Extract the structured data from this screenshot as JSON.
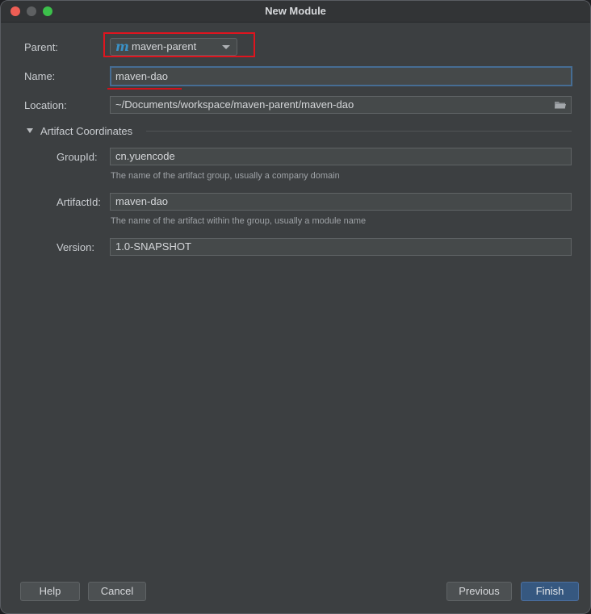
{
  "window": {
    "title": "New Module"
  },
  "form": {
    "parent": {
      "label": "Parent:",
      "value": "maven-parent",
      "icon": "maven-m-icon",
      "icon_glyph": "m"
    },
    "name": {
      "label": "Name:",
      "value": "maven-dao"
    },
    "location": {
      "label": "Location:",
      "value": "~/Documents/workspace/maven-parent/maven-dao",
      "icon": "folder-icon"
    }
  },
  "artifact": {
    "section_label": "Artifact Coordinates",
    "group_id": {
      "label": "GroupId:",
      "value": "cn.yuencode",
      "hint": "The name of the artifact group, usually a company domain"
    },
    "artifact_id": {
      "label": "ArtifactId:",
      "value": "maven-dao",
      "hint": "The name of the artifact within the group, usually a module name"
    },
    "version": {
      "label": "Version:",
      "value": "1.0-SNAPSHOT"
    }
  },
  "buttons": {
    "help": "Help",
    "cancel": "Cancel",
    "previous": "Previous",
    "finish": "Finish"
  },
  "colors": {
    "background": "#3c3f41",
    "field": "#45494a",
    "focus_border": "#466d94",
    "primary_button": "#365880",
    "annotation_red": "#e0141e"
  }
}
